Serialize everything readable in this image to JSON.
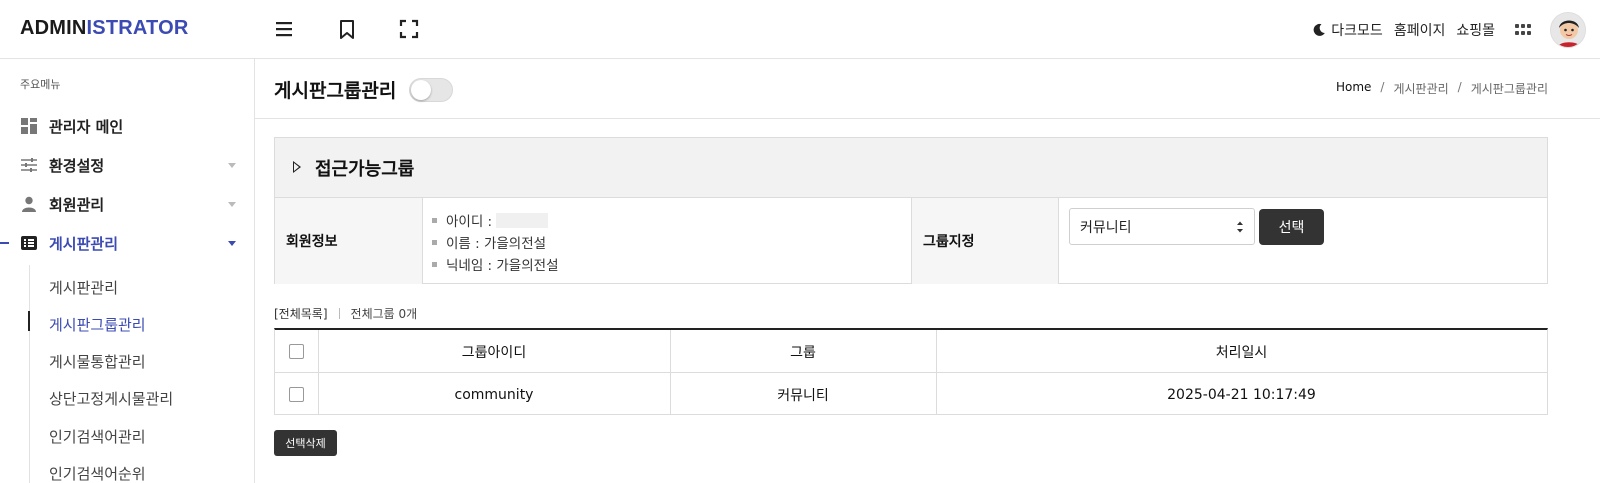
{
  "header": {
    "logo_part1": "ADMIN",
    "logo_part2": "ISTRATOR",
    "links": [
      {
        "label": "다크모드",
        "icon": "moon-icon"
      },
      {
        "label": "홈페이지"
      },
      {
        "label": "쇼핑몰"
      }
    ],
    "colors": {
      "brand": "#3b4bb3"
    }
  },
  "sidebar": {
    "section_title": "주요메뉴",
    "items": [
      {
        "label": "관리자 메인",
        "icon": "dashboard-icon"
      },
      {
        "label": "환경설정",
        "icon": "sliders-icon"
      },
      {
        "label": "회원관리",
        "icon": "user-icon"
      },
      {
        "label": "게시판관리",
        "icon": "list-icon",
        "active": true
      }
    ],
    "submenu": [
      {
        "label": "게시판관리"
      },
      {
        "label": "게시판그룹관리",
        "active": true
      },
      {
        "label": "게시물통합관리"
      },
      {
        "label": "상단고정게시물관리"
      },
      {
        "label": "인기검색어관리"
      },
      {
        "label": "인기검색어순위"
      }
    ]
  },
  "page": {
    "title": "게시판그룹관리",
    "breadcrumb": [
      "Home",
      "게시판관리",
      "게시판그룹관리"
    ]
  },
  "panel": {
    "title": "접근가능그룹",
    "member_label": "회원정보",
    "member_info": [
      "아이디 :",
      "이름 : 가을의전설",
      "닉네임 : 가을의전설"
    ],
    "group_label": "그룹지정",
    "select_value": "커뮤니티",
    "select_button": "선택"
  },
  "list": {
    "title": "[전체목록]",
    "count": "전체그룹 0개",
    "columns": [
      "그룹아이디",
      "그룹",
      "처리일시"
    ],
    "rows": [
      {
        "group_id": "community",
        "group": "커뮤니티",
        "date": "2025-04-21 10:17:49"
      }
    ],
    "delete_button": "선택삭제"
  }
}
